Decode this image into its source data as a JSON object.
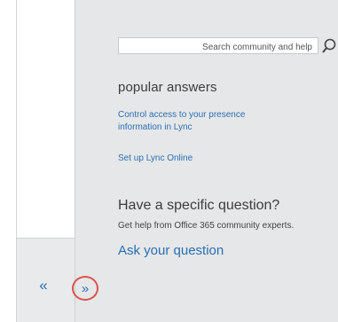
{
  "search": {
    "placeholder": "Search community and help"
  },
  "popular": {
    "heading": "popular answers",
    "links": [
      "Control access to your presence information in Lync",
      "Set up Lync Online"
    ]
  },
  "question": {
    "heading": "Have a specific question?",
    "help_text": "Get help from Office 365 community experts.",
    "ask_link": "Ask your question"
  },
  "nav": {
    "collapse_glyph": "«",
    "expand_glyph": "»"
  },
  "colors": {
    "link": "#2a6fb5",
    "panel_bg": "#e6e7e8",
    "highlight": "#d9534f"
  }
}
